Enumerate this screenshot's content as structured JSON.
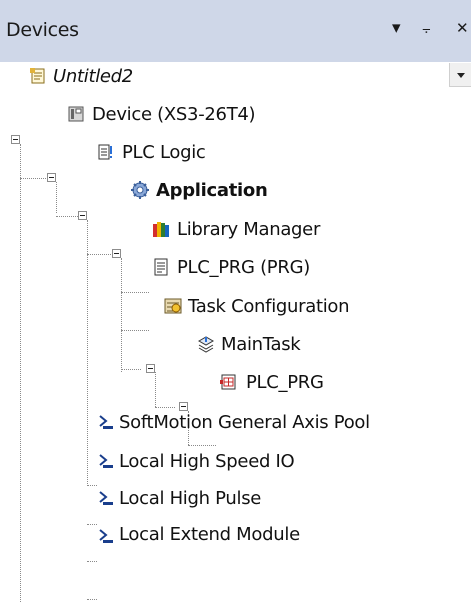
{
  "panel": {
    "title": "Devices",
    "pin_glyph": "⨪",
    "close_glyph": "✕",
    "menu_glyph": "▾"
  },
  "tree": [
    {
      "label": "Untitled2",
      "icon": "project-icon"
    },
    {
      "label": "Device (XS3-26T4)",
      "icon": "device-icon"
    },
    {
      "label": "PLC Logic",
      "icon": "plc-logic-icon"
    },
    {
      "label": "Application",
      "icon": "application-gear-icon"
    },
    {
      "label": "Library Manager",
      "icon": "library-manager-icon"
    },
    {
      "label": "PLC_PRG (PRG)",
      "icon": "program-icon"
    },
    {
      "label": "Task Configuration",
      "icon": "task-configuration-icon"
    },
    {
      "label": "MainTask",
      "icon": "task-icon"
    },
    {
      "label": "PLC_PRG",
      "icon": "program-call-icon"
    },
    {
      "label": "SoftMotion General Axis Pool",
      "icon": "softmotion-icon"
    },
    {
      "label": "Local High Speed IO",
      "icon": "io-module-icon"
    },
    {
      "label": "Local High Pulse",
      "icon": "io-module-icon"
    },
    {
      "label": "Local Extend Module",
      "icon": "io-module-icon"
    }
  ]
}
